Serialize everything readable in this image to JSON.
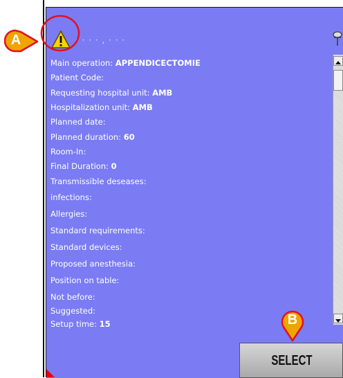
{
  "header": {
    "title_partial": "· · · · , · · ·"
  },
  "fields": [
    {
      "label": "Main operation:",
      "value": "APPENDICECTOMIE"
    },
    {
      "label": "Patient Code:",
      "value": ""
    },
    {
      "label": "Requesting hospital unit:",
      "value": "AMB"
    },
    {
      "label": "Hospitalization unit:",
      "value": "AMB"
    },
    {
      "label": "Planned date:",
      "value": ""
    },
    {
      "label": "Planned duration:",
      "value": "60"
    },
    {
      "label": "Room-In:",
      "value": ""
    },
    {
      "label": "Final Duration:",
      "value": "0"
    },
    {
      "label": "Transmissible deseases:",
      "value": ""
    },
    {
      "label": "infections:",
      "value": ""
    },
    {
      "label": "Allergies:",
      "value": ""
    },
    {
      "label": "Standard requirements:",
      "value": ""
    },
    {
      "label": "Standard devices:",
      "value": ""
    },
    {
      "label": "Proposed anesthesia:",
      "value": ""
    },
    {
      "label": "Position on table:",
      "value": ""
    },
    {
      "label": "Not before:",
      "value": ""
    },
    {
      "label": "Suggested:",
      "value": ""
    },
    {
      "label": "Setup time:",
      "value": "15"
    }
  ],
  "select_button": {
    "label": "SELECT"
  },
  "callouts": {
    "a": "A",
    "b": "B"
  },
  "colors": {
    "panel": "#7b7cf3",
    "callout_fill": "#f0a400",
    "callout_ring": "#e01020"
  },
  "icons": {
    "warning": "warning-icon",
    "pin": "pin-icon"
  }
}
